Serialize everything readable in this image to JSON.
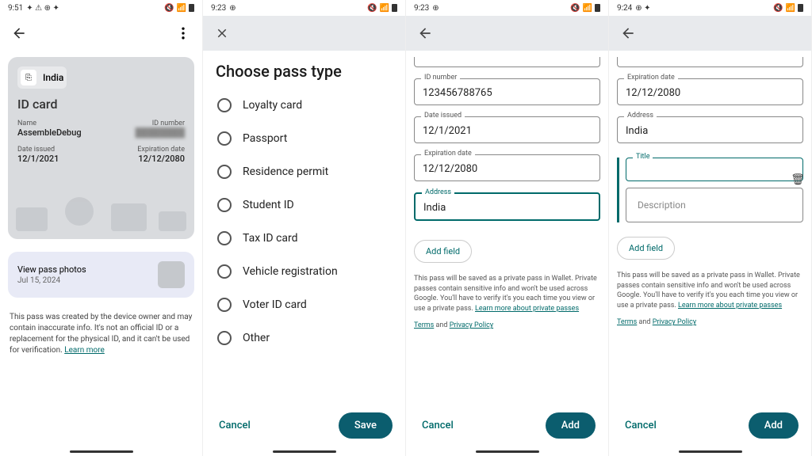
{
  "screens": {
    "s1": {
      "time": "9:51",
      "card": {
        "country": "India",
        "title": "ID card",
        "name_label": "Name",
        "name_value": "AssembleDebug",
        "id_label": "ID number",
        "issued_label": "Date issued",
        "issued_value": "12/1/2021",
        "exp_label": "Expiration date",
        "exp_value": "12/12/2080"
      },
      "photos": {
        "title": "View pass photos",
        "date": "Jul 15, 2024"
      },
      "disclaimer": "This pass was created by the device owner and may contain inaccurate info. It's not an official ID or a replacement for the physical ID, and it can't be used for verification. ",
      "learn_more": "Learn more"
    },
    "s2": {
      "time": "9:23",
      "heading": "Choose pass type",
      "options": [
        "Loyalty card",
        "Passport",
        "Residence permit",
        "Student ID",
        "Tax ID card",
        "Vehicle registration",
        "Voter ID card",
        "Other"
      ],
      "cancel": "Cancel",
      "save": "Save"
    },
    "s3": {
      "time": "9:23",
      "fields": {
        "id_label": "ID number",
        "id_value": "123456788765",
        "issued_label": "Date issued",
        "issued_value": "12/1/2021",
        "exp_label": "Expiration date",
        "exp_value": "12/12/2080",
        "addr_label": "Address",
        "addr_value": "India"
      },
      "add_field": "Add field",
      "info": "This pass will be saved as a private pass in Wallet. Private passes contain sensitive info and won't be used across Google. You'll have to verify it's you each time you view or use a private pass. ",
      "learn_more_pp": "Learn more about private passes",
      "terms": "Terms",
      "and": " and ",
      "privacy": "Privacy Policy",
      "cancel": "Cancel",
      "add": "Add"
    },
    "s4": {
      "time": "9:24",
      "fields": {
        "exp_label": "Expiration date",
        "exp_value": "12/12/2080",
        "addr_label": "Address",
        "addr_value": "India",
        "title_label": "Title",
        "desc_label": "Description"
      },
      "add_field": "Add field",
      "info": "This pass will be saved as a private pass in Wallet. Private passes contain sensitive info and won't be used across Google. You'll have to verify it's you each time you view or use a private pass. ",
      "learn_more_pp": "Learn more about private passes",
      "terms": "Terms",
      "and": " and ",
      "privacy": "Privacy Policy",
      "cancel": "Cancel",
      "add": "Add"
    }
  }
}
